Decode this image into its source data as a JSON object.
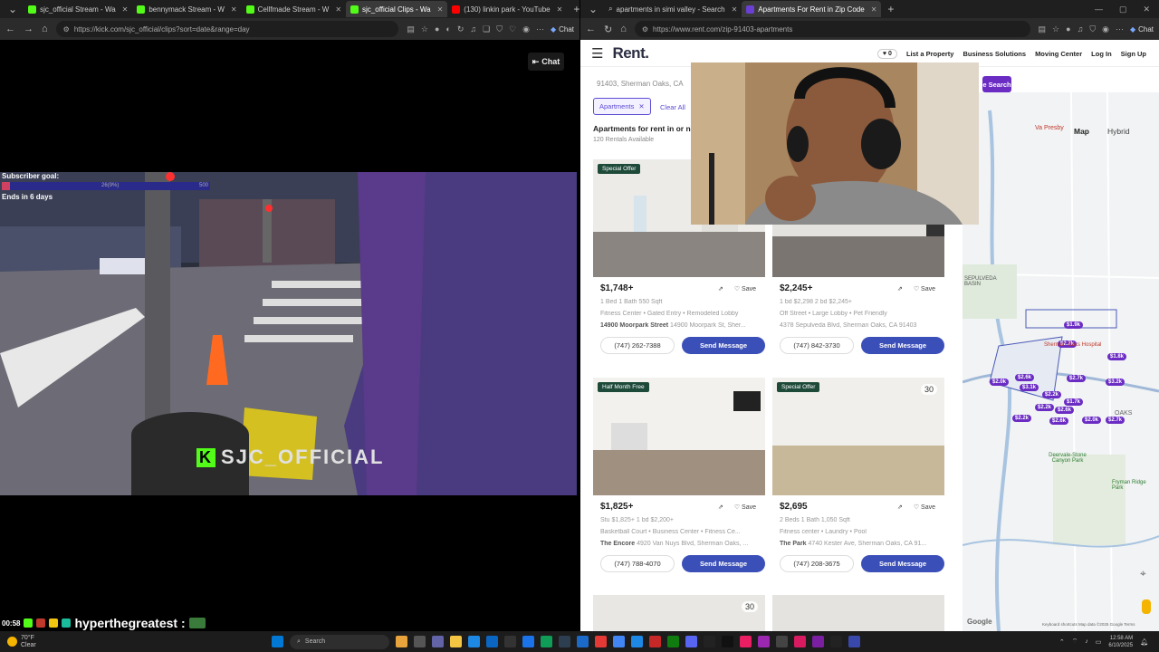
{
  "left_window": {
    "tabs": [
      {
        "label": "sjc_official Stream - Wa",
        "icon_color": "#53fc18"
      },
      {
        "label": "bennymack Stream - W",
        "icon_color": "#53fc18"
      },
      {
        "label": "Cellfmade Stream - W",
        "icon_color": "#53fc18"
      },
      {
        "label": "sjc_official Clips - Wa",
        "icon_color": "#53fc18"
      },
      {
        "label": "(130) linkin park - YouTube",
        "icon_color": "#ff0000"
      }
    ],
    "url": "https://kick.com/sjc_official/clips?sort=date&range=day",
    "chat_pill": "Chat",
    "chat_button": "Chat",
    "subscriber_goal_label": "Subscriber goal:",
    "goal_current": "26(9%)",
    "goal_max": "500",
    "goal_progress": 0.04,
    "ends_label": "Ends in 6 days",
    "stream_watermark": "SJC_OFFICIAL",
    "overlay_time": "00:58",
    "overlay_user": "hyperthegreatest :"
  },
  "right_window": {
    "tabs": [
      {
        "label": "apartments in simi valley - Search",
        "icon_color": "#888888"
      },
      {
        "label": "Apartments For Rent in Zip Code",
        "icon_color": "#6b3fd4"
      }
    ],
    "url": "https://www.rent.com/zip-91403-apartments",
    "chat_pill": "Chat",
    "logo": "Rent.",
    "nav": {
      "hearts": "0",
      "list_property": "List a Property",
      "business": "Business Solutions",
      "moving": "Moving Center",
      "login": "Log In",
      "signup": "Sign Up"
    },
    "location": "91403, Sherman Oaks, CA",
    "chip": "Apartments",
    "clear_all": "Clear All",
    "search_button": "e Search",
    "heading": "Apartments for rent in or ne",
    "count": "120 Rentals Available",
    "map_toggle": {
      "map": "Map",
      "hybrid": "Hybrid"
    },
    "listings": [
      {
        "tag": "Special Offer",
        "number": "",
        "price": "$1,748+",
        "details": "1 Bed    1 Bath    550 Sqft",
        "amenities": "Fitness Center  •  Gated Entry  •  Remodeled Lobby",
        "name": "14900 Moorpark Street",
        "address": "14900 Moorpark St, Sher...",
        "phone": "(747) 262-7388",
        "message": "Send Message",
        "share": "⇗",
        "save": "♡ Save"
      },
      {
        "tag": "",
        "number": "",
        "price": "$2,245+",
        "details": "1 bd $2,298    2 bd $2,245+",
        "amenities": "Off Street  •  Large Lobby  •  Pet Friendly",
        "name": "",
        "address": "4378 Sepulveda Blvd, Sherman Oaks, CA 91403",
        "phone": "(747) 842-3730",
        "message": "Send Message",
        "share": "⇗",
        "save": "♡ Save"
      },
      {
        "tag": "Half Month Free",
        "number": "",
        "price": "$1,825+",
        "details": "Stu $1,825+    1 bd $2,200+",
        "amenities": "Basketball Court  •  Business Center  •  Fitness Ce...",
        "name": "The Encore",
        "address": "4920 Van Nuys Blvd, Sherman Oaks, ...",
        "phone": "(747) 788-4070",
        "message": "Send Message",
        "share": "⇗",
        "save": "♡ Save"
      },
      {
        "tag": "Special Offer",
        "number": "30",
        "price": "$2,695",
        "details": "2 Beds    1 Bath    1,050 Sqft",
        "amenities": "Fitness center  •  Laundry  •  Pool",
        "name": "The Park",
        "address": "4740 Kester Ave, Sherman Oaks, CA 91...",
        "phone": "(747) 208-3675",
        "message": "Send Message",
        "share": "⇗",
        "save": "♡ Save"
      }
    ],
    "next_card_number": "30",
    "map_labels": {
      "hospital": "Sherman Oaks Hospital",
      "basin": "SEPULVEDA BASIN",
      "park": "Deervale-Stone Canyon Park",
      "ridge": "Fryman Ridge Park",
      "oaks": "OAKS",
      "presby": "Va Presby",
      "google": "Google",
      "credits": "Keyboard shortcuts   Map data ©2025 Google   Terms"
    },
    "map_prices": [
      "$1.9k",
      "$2.7k",
      "$1.8k",
      "$2.0k",
      "$2.6k",
      "$3.1k",
      "$2.7k",
      "$2.2k",
      "$3.2k",
      "$2.2k",
      "$2.6k",
      "$1.7k",
      "$2.6k",
      "$2.2k",
      "$2.0k",
      "$2.7k"
    ]
  },
  "taskbar": {
    "temp": "70°F",
    "condition": "Clear",
    "search": "Search",
    "time": "12:58 AM",
    "date": "6/10/2025"
  },
  "colors": {
    "kick_green": "#53fc18",
    "rent_purple": "#6b2cc4",
    "send_blue": "#3b4fb8",
    "map_pin": "#6b2cc4"
  }
}
